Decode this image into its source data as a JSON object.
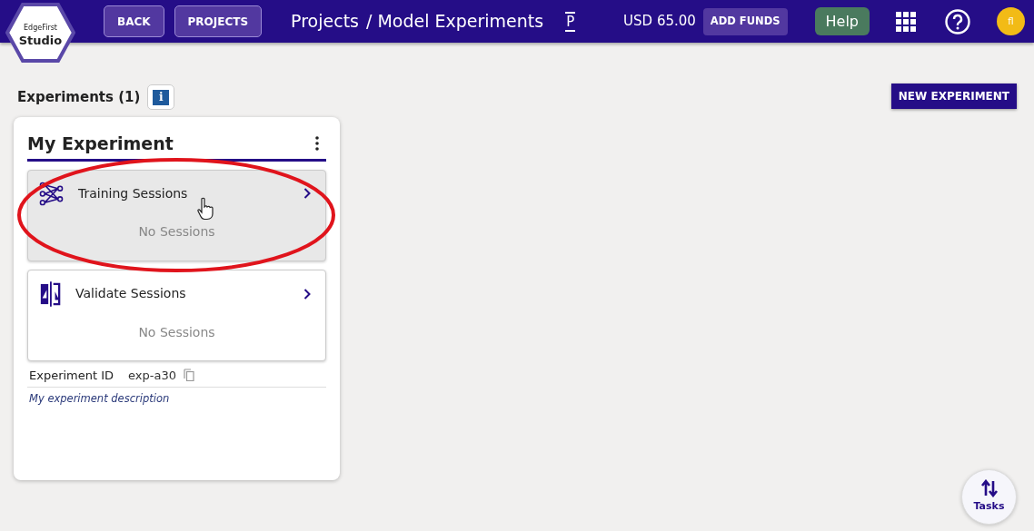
{
  "logo": {
    "line1": "EdgeFirst",
    "line2": "Studio"
  },
  "nav_buttons": [
    "BACK",
    "PROJECTS"
  ],
  "breadcrumb": [
    "Projects",
    "/ Model Experiments"
  ],
  "tab_marker": "P",
  "balance": "USD 65.00",
  "add_funds": "ADD FUNDS",
  "help": "Help",
  "avatar": "fl",
  "heading": "Experiments (1)",
  "info_icon": "i",
  "new_experiment": "NEW EXPERIMENT",
  "experiment": {
    "title": "My Experiment",
    "sections": [
      {
        "kind": "training",
        "title": "Training Sessions",
        "empty": "No Sessions",
        "hovered": true
      },
      {
        "kind": "validate",
        "title": "Validate Sessions",
        "empty": "No Sessions",
        "hovered": false
      }
    ],
    "id_label": "Experiment ID",
    "id_value": "exp-a30",
    "description": "My experiment description"
  },
  "tasks": "Tasks"
}
